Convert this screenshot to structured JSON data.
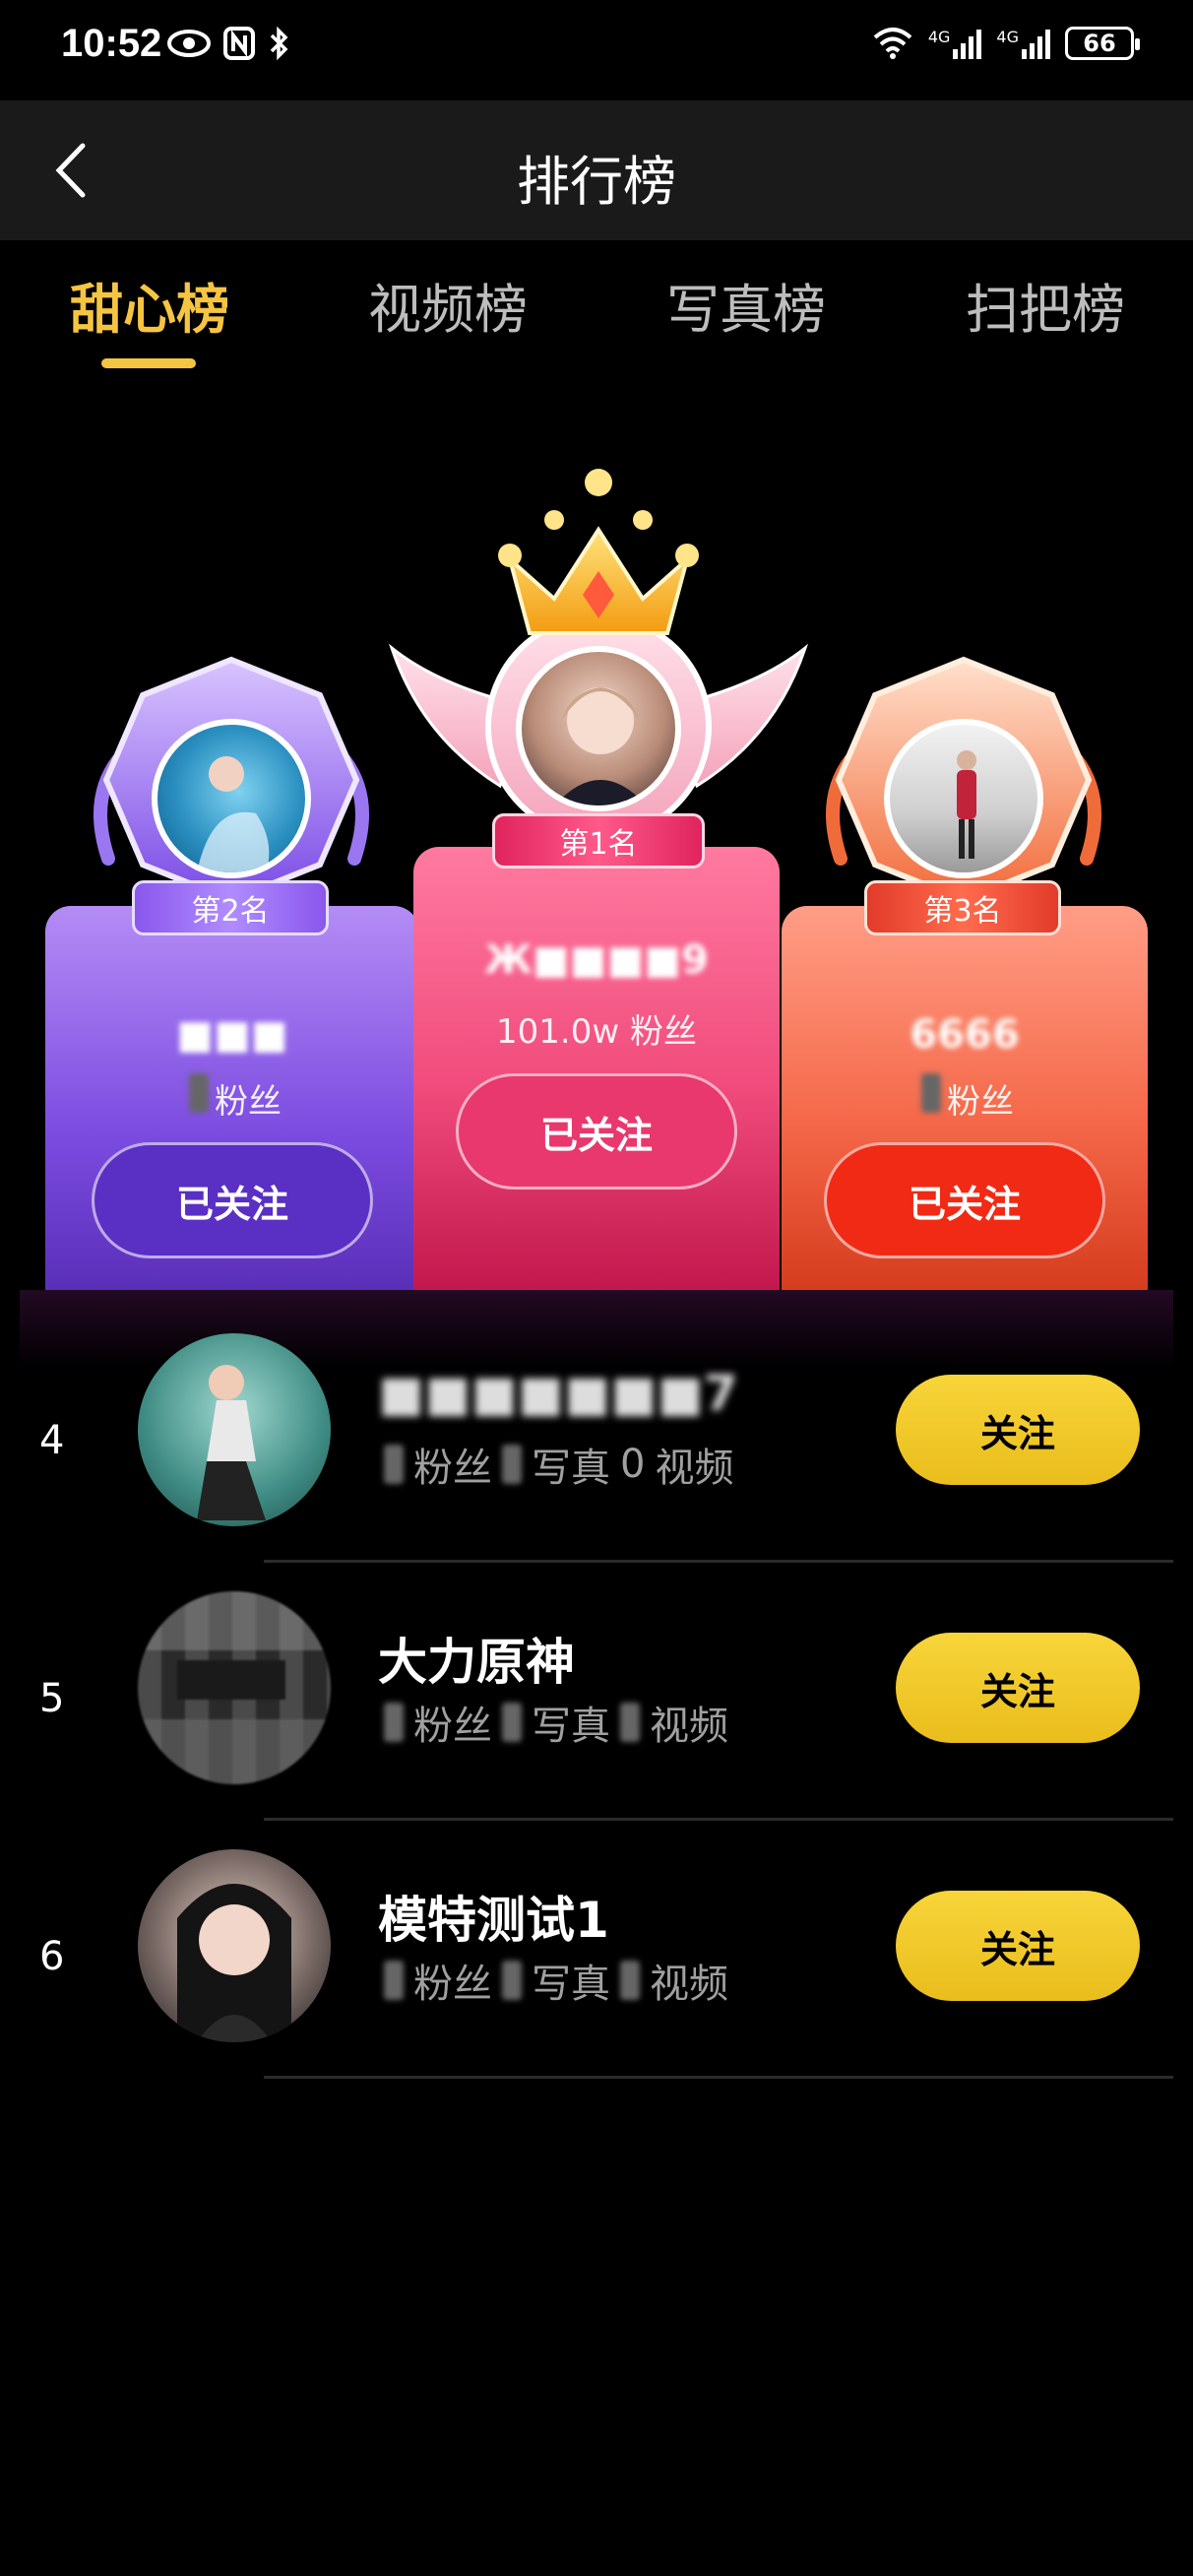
{
  "status_bar": {
    "time": "10:52",
    "battery": "66",
    "signal_label_1": "4G",
    "signal_label_2": "4G"
  },
  "header": {
    "title": "排行榜"
  },
  "tabs": [
    {
      "label": "甜心榜",
      "active": true
    },
    {
      "label": "视频榜",
      "active": false
    },
    {
      "label": "写真榜",
      "active": false
    },
    {
      "label": "扫把榜",
      "active": false
    }
  ],
  "podium": {
    "first": {
      "rank_label": "第1名",
      "name": "Ж■■■■9",
      "fans": "101.0w 粉丝",
      "follow_label": "已关注"
    },
    "second": {
      "rank_label": "第2名",
      "name": "■■■",
      "fans": "粉丝",
      "follow_label": "已关注"
    },
    "third": {
      "rank_label": "第3名",
      "name": "6666",
      "fans": "粉丝",
      "follow_label": "已关注"
    }
  },
  "list": [
    {
      "rank": "4",
      "name": "■■■■■■■7",
      "fans_label": "粉丝",
      "photos_label": "写真",
      "photos_value": "0",
      "videos_label": "视频",
      "follow_label": "关注"
    },
    {
      "rank": "5",
      "name": "大力原神",
      "fans_label": "粉丝",
      "photos_label": "写真",
      "videos_label": "视频",
      "follow_label": "关注"
    },
    {
      "rank": "6",
      "name": "模特测试1",
      "fans_label": "粉丝",
      "photos_label": "写真",
      "videos_label": "视频",
      "follow_label": "关注"
    }
  ],
  "colors": {
    "accent": "#f5c542",
    "follow_yellow": "#f1c929",
    "rank2_purple": "#7b4be0",
    "rank1_pink": "#f04a7b",
    "rank3_orange": "#f5694a"
  }
}
